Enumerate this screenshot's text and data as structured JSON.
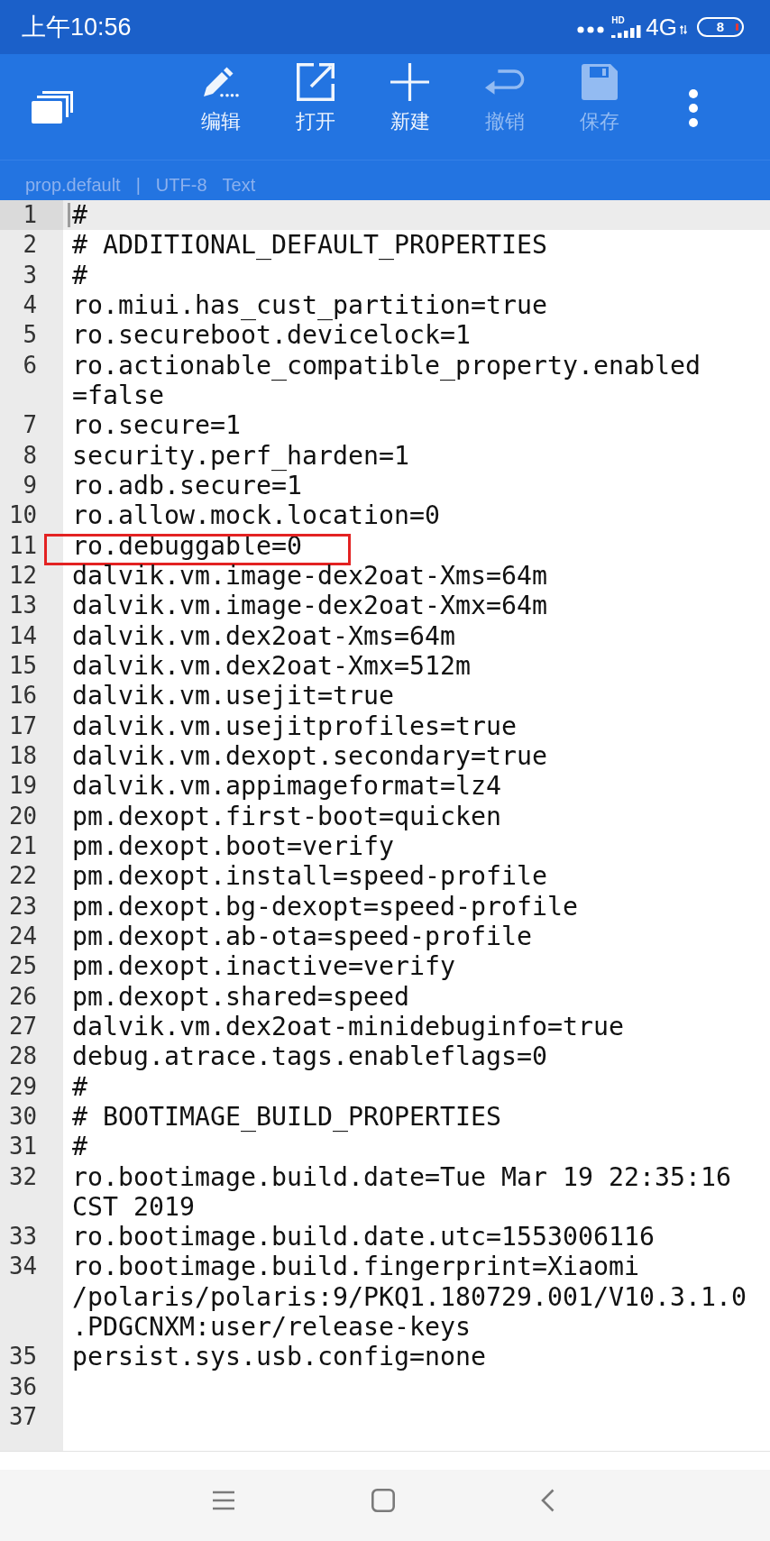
{
  "status_bar": {
    "time": "上午10:56",
    "signal_label": "HD",
    "network": "4G",
    "battery": "8"
  },
  "toolbar": {
    "actions": [
      {
        "label": "编辑",
        "disabled": false
      },
      {
        "label": "打开",
        "disabled": false
      },
      {
        "label": "新建",
        "disabled": false
      },
      {
        "label": "撤销",
        "disabled": true
      },
      {
        "label": "保存",
        "disabled": true
      }
    ]
  },
  "file_info": {
    "file_name": "prop.default",
    "separator": "|",
    "encoding": "UTF-8",
    "syntax": "Text"
  },
  "editor": {
    "lines": [
      {
        "number": "1",
        "text": "#",
        "selected": true,
        "outlined": false
      },
      {
        "number": "2",
        "text": "# ADDITIONAL_DEFAULT_PROPERTIES",
        "selected": false,
        "outlined": false
      },
      {
        "number": "3",
        "text": "#",
        "selected": false,
        "outlined": false
      },
      {
        "number": "4",
        "text": "ro.miui.has_cust_partition=true",
        "selected": false,
        "outlined": false
      },
      {
        "number": "5",
        "text": "ro.secureboot.devicelock=1",
        "selected": false,
        "outlined": false
      },
      {
        "number": "6",
        "text": "ro.actionable_compatible_property.enabled=false",
        "selected": false,
        "outlined": false
      },
      {
        "number": "7",
        "text": "ro.secure=1",
        "selected": false,
        "outlined": false
      },
      {
        "number": "8",
        "text": "security.perf_harden=1",
        "selected": false,
        "outlined": false
      },
      {
        "number": "9",
        "text": "ro.adb.secure=1",
        "selected": false,
        "outlined": false
      },
      {
        "number": "10",
        "text": "ro.allow.mock.location=0",
        "selected": false,
        "outlined": false
      },
      {
        "number": "11",
        "text": "ro.debuggable=0",
        "selected": false,
        "outlined": true
      },
      {
        "number": "12",
        "text": "dalvik.vm.image-dex2oat-Xms=64m",
        "selected": false,
        "outlined": false
      },
      {
        "number": "13",
        "text": "dalvik.vm.image-dex2oat-Xmx=64m",
        "selected": false,
        "outlined": false
      },
      {
        "number": "14",
        "text": "dalvik.vm.dex2oat-Xms=64m",
        "selected": false,
        "outlined": false
      },
      {
        "number": "15",
        "text": "dalvik.vm.dex2oat-Xmx=512m",
        "selected": false,
        "outlined": false
      },
      {
        "number": "16",
        "text": "dalvik.vm.usejit=true",
        "selected": false,
        "outlined": false
      },
      {
        "number": "17",
        "text": "dalvik.vm.usejitprofiles=true",
        "selected": false,
        "outlined": false
      },
      {
        "number": "18",
        "text": "dalvik.vm.dexopt.secondary=true",
        "selected": false,
        "outlined": false
      },
      {
        "number": "19",
        "text": "dalvik.vm.appimageformat=lz4",
        "selected": false,
        "outlined": false
      },
      {
        "number": "20",
        "text": "pm.dexopt.first-boot=quicken",
        "selected": false,
        "outlined": false
      },
      {
        "number": "21",
        "text": "pm.dexopt.boot=verify",
        "selected": false,
        "outlined": false
      },
      {
        "number": "22",
        "text": "pm.dexopt.install=speed-profile",
        "selected": false,
        "outlined": false
      },
      {
        "number": "23",
        "text": "pm.dexopt.bg-dexopt=speed-profile",
        "selected": false,
        "outlined": false
      },
      {
        "number": "24",
        "text": "pm.dexopt.ab-ota=speed-profile",
        "selected": false,
        "outlined": false
      },
      {
        "number": "25",
        "text": "pm.dexopt.inactive=verify",
        "selected": false,
        "outlined": false
      },
      {
        "number": "26",
        "text": "pm.dexopt.shared=speed",
        "selected": false,
        "outlined": false
      },
      {
        "number": "27",
        "text": "dalvik.vm.dex2oat-minidebuginfo=true",
        "selected": false,
        "outlined": false
      },
      {
        "number": "28",
        "text": "debug.atrace.tags.enableflags=0",
        "selected": false,
        "outlined": false
      },
      {
        "number": "29",
        "text": "#",
        "selected": false,
        "outlined": false
      },
      {
        "number": "30",
        "text": "# BOOTIMAGE_BUILD_PROPERTIES",
        "selected": false,
        "outlined": false
      },
      {
        "number": "31",
        "text": "#",
        "selected": false,
        "outlined": false
      },
      {
        "number": "32",
        "text": "ro.bootimage.build.date=Tue Mar 19 22:35:16 CST 2019",
        "selected": false,
        "outlined": false
      },
      {
        "number": "33",
        "text": "ro.bootimage.build.date.utc=1553006116",
        "selected": false,
        "outlined": false
      },
      {
        "number": "34",
        "text": "ro.bootimage.build.fingerprint=Xiaomi/polaris/polaris:9/PKQ1.180729.001/V10.3.1.0.PDGCNXM:user/release-keys",
        "selected": false,
        "outlined": false
      },
      {
        "number": "35",
        "text": "persist.sys.usb.config=none",
        "selected": false,
        "outlined": false
      },
      {
        "number": "36",
        "selected": false,
        "outlined": false
      },
      {
        "number": "37",
        "selected": false,
        "outlined": false
      }
    ]
  }
}
